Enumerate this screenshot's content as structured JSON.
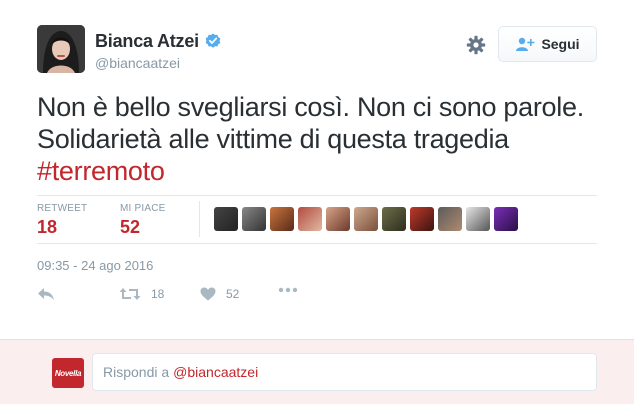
{
  "author": {
    "name": "Bianca Atzei",
    "handle": "@biancaatzei",
    "verified": true
  },
  "follow_button": {
    "label": "Segui"
  },
  "tweet": {
    "line1": "Non è bello svegliarsi così. Non ci sono parole.",
    "line2": "Solidarietà alle vittime di questa tragedia",
    "hashtag": "#terremoto"
  },
  "stats": {
    "retweet_label": "RETWEET",
    "retweet_count": "18",
    "likes_label": "MI PIACE",
    "likes_count": "52"
  },
  "timestamp": "09:35 - 24 ago 2016",
  "actions": {
    "reply_icon": "reply-icon",
    "retweet_icon": "retweet-icon",
    "retweet_count": "18",
    "like_icon": "heart-icon",
    "like_count": "52",
    "more_icon": "more-icon"
  },
  "reply": {
    "logo_text": "Novella",
    "prompt": "Rispondi a",
    "mention": "@biancaatzei"
  },
  "colors": {
    "accent": "#c1272d",
    "muted": "#8899a6",
    "verified": "#55acee",
    "reply_bg": "#fbeeef"
  }
}
